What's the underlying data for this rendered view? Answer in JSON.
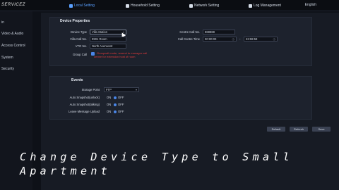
{
  "header": {
    "brand": "SERVICEZ",
    "tabs": [
      {
        "label": "Local Setting",
        "icon": "gear-icon",
        "active": true
      },
      {
        "label": "Household Setting",
        "icon": "home-icon",
        "active": false
      },
      {
        "label": "Network Setting",
        "icon": "globe-icon",
        "active": false
      },
      {
        "label": "Log Management",
        "icon": "document-icon",
        "active": false
      }
    ],
    "language": "English"
  },
  "sidebar": {
    "items": [
      {
        "label": "in"
      },
      {
        "label": "Video & Audio"
      },
      {
        "label": "Access Control"
      },
      {
        "label": "System"
      },
      {
        "label": "Security"
      }
    ]
  },
  "device_properties": {
    "title": "Device Properties",
    "device_type_label": "Device Type",
    "device_type_value": "Villa Station",
    "villa_call_no_label": "Villa Call No.",
    "villa_call_no_value": "9901 Room",
    "vto_no_label": "VTO No.",
    "vto_no_value": "North Avenwest",
    "group_call_label": "Group Call",
    "group_call_warning_line1": "Groupcall mode, resend to manager call",
    "group_call_warning_line2": "centre for extension host of room",
    "centre_call_no_label": "Centre Call No.",
    "centre_call_no_value": "888888",
    "call_centre_time_label": "Call Centre Time",
    "call_centre_time_start": "00:00:00",
    "call_centre_time_end": "23:59:59"
  },
  "events": {
    "title": "Events",
    "storage_point_label": "Storage Point",
    "storage_point_value": "FTP",
    "rows": [
      {
        "label": "Auto Snapshot(unlock)",
        "on": "ON",
        "off": "OFF",
        "selected": "off"
      },
      {
        "label": "Auto Snapshot(talking)",
        "on": "ON",
        "off": "OFF",
        "selected": "off"
      },
      {
        "label": "Leave Message Upload",
        "on": "ON",
        "off": "OFF",
        "selected": "off"
      }
    ]
  },
  "buttons": {
    "default": "Default",
    "refresh": "Refresh",
    "save": "Save"
  },
  "caption": {
    "line1": "Change Device Type to Small",
    "line2": "Apartment"
  },
  "colors": {
    "accent": "#4a86e8",
    "warning": "#e33a3a"
  }
}
